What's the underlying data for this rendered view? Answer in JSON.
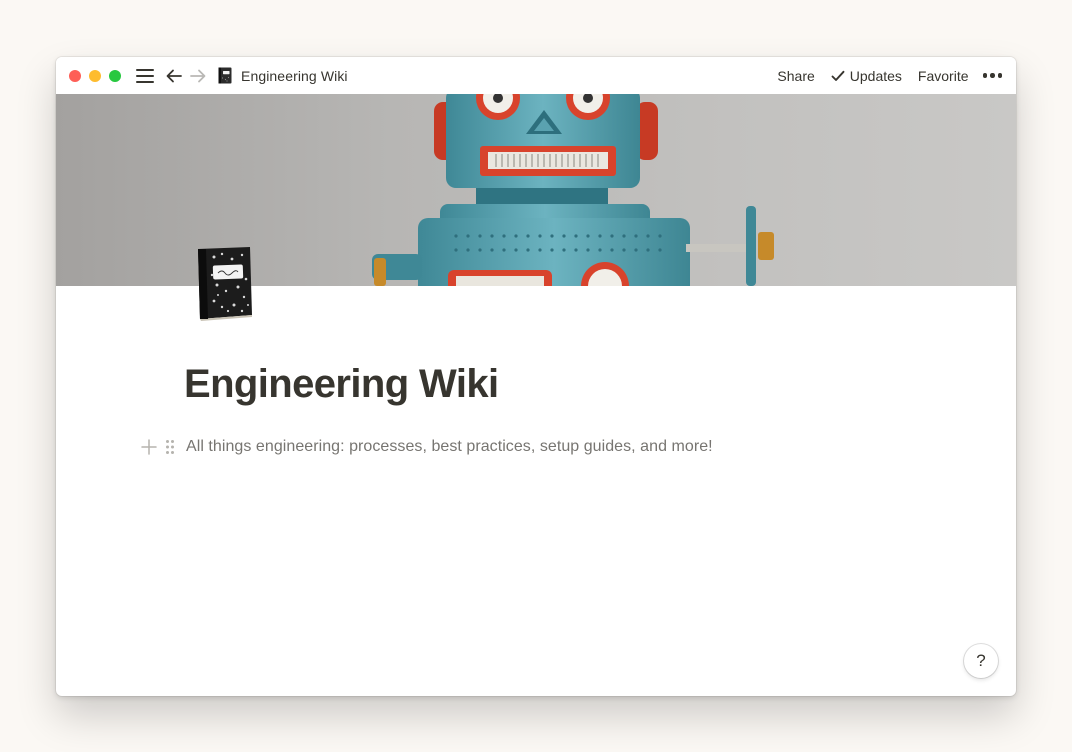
{
  "titlebar": {
    "menu_icon": "hamburger-menu-icon",
    "back_icon": "arrow-left-icon",
    "forward_icon": "arrow-right-icon",
    "page_icon": "composition-notebook-icon",
    "page_title": "Engineering Wiki",
    "share_label": "Share",
    "updates_label": "Updates",
    "favorite_label": "Favorite",
    "more_icon": "more-dots-icon"
  },
  "cover": {
    "image": "toy-robot-cover"
  },
  "page": {
    "icon": "composition-notebook-icon",
    "title": "Engineering Wiki",
    "description": "All things engineering: processes, best practices, setup guides, and more!"
  },
  "help": {
    "label": "?"
  },
  "colors": {
    "text": "#37352f",
    "muted_text": "#777571",
    "background": "#fbf8f4",
    "robot_teal": "#5fa6b4",
    "robot_red": "#d8432c"
  }
}
